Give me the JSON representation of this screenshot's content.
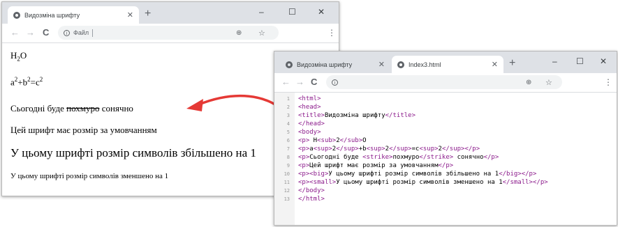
{
  "window1": {
    "tab_title": "Видозміна шрифту",
    "address": "Файл",
    "page": {
      "h2o": {
        "base": "H",
        "sub": "2",
        "tail": "O"
      },
      "formula": {
        "a": "a",
        "p1": "2",
        "plus": "+b",
        "p2": "2",
        "eq": "=c",
        "p3": "2"
      },
      "strike_line": {
        "before": "Сьогодні буде ",
        "strike": "похмуро",
        "after": " сонячно"
      },
      "normal_line": "Цей шрифт має розмір за умовчанням",
      "big_line": "У цьому шрифті розмір символів збільшено на 1",
      "small_line": "У цьому шрифті розмір символів зменшено на 1"
    }
  },
  "window2": {
    "tabs": [
      {
        "label": "Видозміна шрифту"
      },
      {
        "label": "Index3.html"
      }
    ],
    "code": [
      {
        "n": "1",
        "text": "<html>"
      },
      {
        "n": "2",
        "text": "<head>"
      },
      {
        "n": "3",
        "text": "<title>Видозміна шрифту</title>"
      },
      {
        "n": "4",
        "text": "</head>"
      },
      {
        "n": "5",
        "text": "<body>"
      },
      {
        "n": "6",
        "text": "<p> H<sub>2</sub>O"
      },
      {
        "n": "7",
        "text": "<p>a<sup>2</sup>+b<sup>2</sup>=c<sup>2</sup></p>"
      },
      {
        "n": "8",
        "text": "<p>Сьогодні буде <strike>похмуро</strike> сонячно</p>"
      },
      {
        "n": "9",
        "text": "<p>Цей шрифт має розмір за умовчанням</p>"
      },
      {
        "n": "10",
        "text": "<p><big>У цьому шрифті розмір символів збільшено на 1</big></p>"
      },
      {
        "n": "11",
        "text": "<p><small>У цьому шрифті розмір символів зменшено на 1</small></p>"
      },
      {
        "n": "12",
        "text": "</body>"
      },
      {
        "n": "13",
        "text": "</html>"
      }
    ]
  },
  "icons": {
    "close": "✕",
    "new_tab": "+",
    "minimize": "–",
    "maximize": "☐",
    "back": "←",
    "forward": "→",
    "reload": "C",
    "info": "i",
    "zoom": "⊕",
    "star": "☆",
    "menu": "⋮"
  },
  "colors": {
    "tabbar": "#dee1e6",
    "arrow": "#e53935",
    "code_tag": "#8b1a8b"
  }
}
